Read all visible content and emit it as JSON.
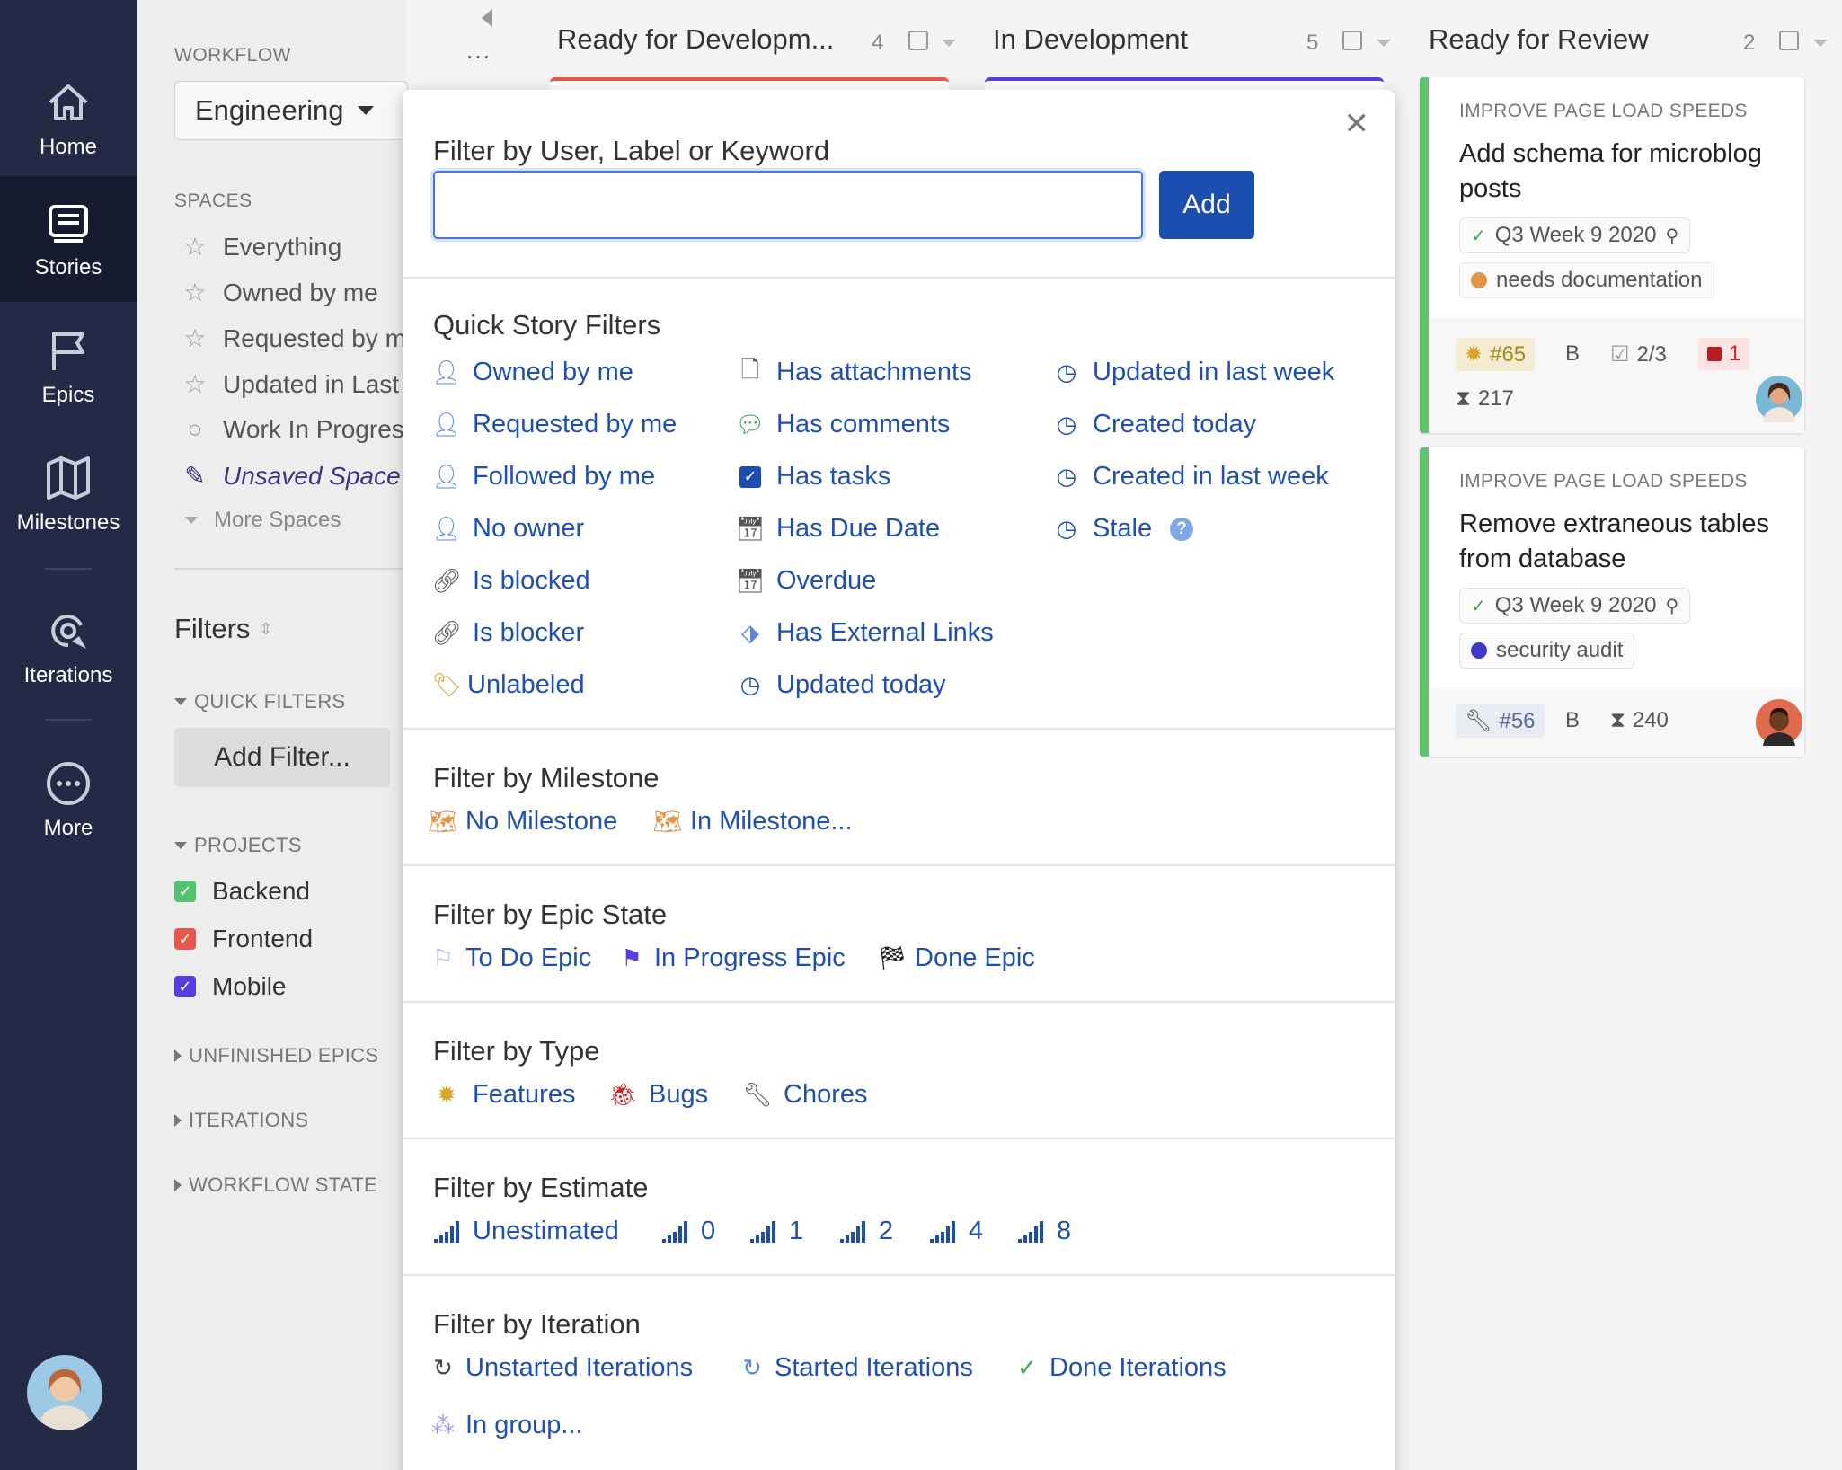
{
  "nav": {
    "items": [
      {
        "label": "Home"
      },
      {
        "label": "Stories"
      },
      {
        "label": "Epics"
      },
      {
        "label": "Milestones"
      },
      {
        "label": "Iterations"
      },
      {
        "label": "More"
      }
    ]
  },
  "sidebar": {
    "workflow_heading": "WORKFLOW",
    "workflow_value": "Engineering",
    "more_dots": "···",
    "spaces_heading": "SPACES",
    "spaces": [
      "Everything",
      "Owned by me",
      "Requested by me",
      "Updated in Last",
      "Work In Progress",
      "Unsaved Space"
    ],
    "more_spaces": "More Spaces",
    "filters_title": "Filters",
    "quick_filters_heading": "QUICK FILTERS",
    "add_filter": "Add Filter...",
    "projects_heading": "PROJECTS",
    "projects": [
      {
        "name": "Backend",
        "color": "#55c26f"
      },
      {
        "name": "Frontend",
        "color": "#e8574d"
      },
      {
        "name": "Mobile",
        "color": "#5a3de0"
      }
    ],
    "collapsed_sections": [
      "UNFINISHED EPICS",
      "ITERATIONS",
      "WORKFLOW STATE"
    ]
  },
  "board": {
    "columns": [
      {
        "title": "Ready for Developm...",
        "count": "4"
      },
      {
        "title": "In Development",
        "count": "5"
      },
      {
        "title": "Ready for Review",
        "count": "2"
      }
    ]
  },
  "cards": [
    {
      "epic": "IMPROVE PAGE LOAD SPEEDS",
      "title": "Add schema for microblog posts",
      "iteration": "Q3 Week 9 2020",
      "label": "needs documentation",
      "label_color": "#e0954a",
      "id": "#65",
      "estimate_letter": "B",
      "tasks": "2/3",
      "blocked_count": "1",
      "age": "217"
    },
    {
      "epic": "IMPROVE PAGE LOAD SPEEDS",
      "title": "Remove extraneous tables from database",
      "iteration": "Q3 Week 9 2020",
      "label": "security audit",
      "label_color": "#3d3ac9",
      "id": "#56",
      "estimate_letter": "B",
      "age": "240"
    }
  ],
  "popover": {
    "search_label": "Filter by User, Label or Keyword",
    "search_value": "",
    "add_button": "Add",
    "quick_heading": "Quick Story Filters",
    "quick_col1": [
      "Owned by me",
      "Requested by me",
      "Followed by me",
      "No owner",
      "Is blocked",
      "Is blocker",
      "Unlabeled"
    ],
    "quick_col2": [
      "Has attachments",
      "Has comments",
      "Has tasks",
      "Has Due Date",
      "Overdue",
      "Has External Links",
      "Updated today"
    ],
    "quick_col3": [
      "Updated in last week",
      "Created today",
      "Created in last week",
      "Stale"
    ],
    "milestone_heading": "Filter by Milestone",
    "milestone_links": [
      "No Milestone",
      "In Milestone..."
    ],
    "epic_heading": "Filter by Epic State",
    "epic_links": [
      "To Do Epic",
      "In Progress Epic",
      "Done Epic"
    ],
    "type_heading": "Filter by Type",
    "type_links": [
      "Features",
      "Bugs",
      "Chores"
    ],
    "estimate_heading": "Filter by Estimate",
    "estimate_links": [
      "Unestimated",
      "0",
      "1",
      "2",
      "4",
      "8"
    ],
    "iteration_heading": "Filter by Iteration",
    "iteration_links": [
      "Unstarted Iterations",
      "Started Iterations",
      "Done Iterations",
      "In group..."
    ]
  }
}
